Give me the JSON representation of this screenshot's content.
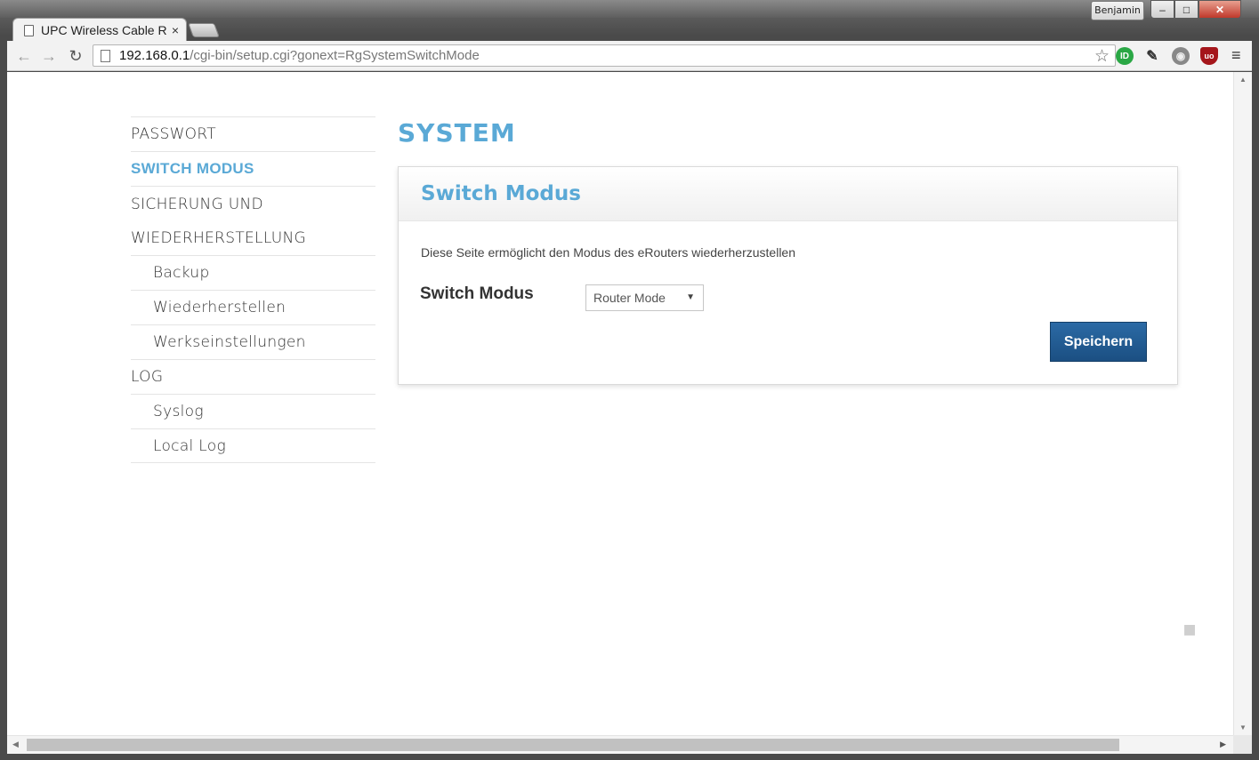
{
  "browser": {
    "profile_name": "Benjamin",
    "tab": {
      "title": "UPC Wireless Cable R",
      "close_glyph": "×"
    },
    "window_controls": {
      "minimize": "–",
      "maximize": "□",
      "close": "✕"
    },
    "nav": {
      "back": "←",
      "forward": "→",
      "reload": "↻"
    },
    "url": {
      "host": "192.168.0.1",
      "path": "/cgi-bin/setup.cgi?gonext=RgSystemSwitchMode"
    },
    "star_icon": "☆",
    "extensions": [
      {
        "name": "id-icon",
        "glyph": "ID"
      },
      {
        "name": "pin-icon",
        "glyph": "✎"
      },
      {
        "name": "ghost-icon",
        "glyph": "◉"
      },
      {
        "name": "ublock-icon",
        "glyph": "uo"
      }
    ],
    "menu_icon": "≡"
  },
  "sidebar": {
    "items": [
      {
        "label": "PASSWORT"
      },
      {
        "label": "SWITCH MODUS",
        "active": true
      },
      {
        "label_line1": "SICHERUNG UND",
        "label_line2": "WIEDERHERSTELLUNG"
      },
      {
        "label": "Backup"
      },
      {
        "label": "Wiederherstellen"
      },
      {
        "label": "Werkseinstellungen"
      },
      {
        "label": "LOG"
      },
      {
        "label": "Syslog"
      },
      {
        "label": "Local Log"
      }
    ]
  },
  "main": {
    "title": "SYSTEM",
    "panel": {
      "title": "Switch Modus",
      "description": "Diese Seite ermöglicht den Modus des eRouters wiederherzustellen",
      "field_label": "Switch Modus",
      "select_value": "Router Mode",
      "save_label": "Speichern"
    }
  },
  "colors": {
    "accent": "#5aa9d6",
    "button": "#1f5a92"
  }
}
